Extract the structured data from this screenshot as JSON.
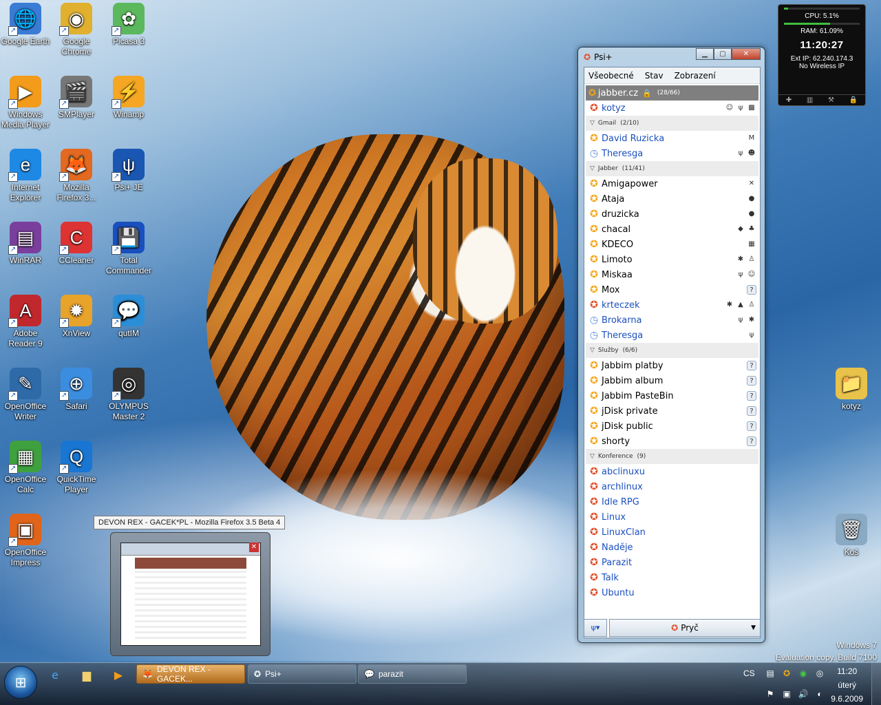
{
  "desktop": {
    "icons": [
      {
        "label": "Google Earth",
        "glyph": "🌐"
      },
      {
        "label": "Google Chrome",
        "glyph": "◉"
      },
      {
        "label": "Picasa 3",
        "glyph": "✿"
      },
      {
        "label": "Windows Media Player",
        "glyph": "▶"
      },
      {
        "label": "SMPlayer",
        "glyph": "🎬"
      },
      {
        "label": "Winamp",
        "glyph": "⚡"
      },
      {
        "label": "Internet Explorer",
        "glyph": "e"
      },
      {
        "label": "Mozilla Firefox 3...",
        "glyph": "🦊"
      },
      {
        "label": "Psi+ JE",
        "glyph": "ψ"
      },
      {
        "label": "WinRAR",
        "glyph": "▤"
      },
      {
        "label": "CCleaner",
        "glyph": "C"
      },
      {
        "label": "Total Commander",
        "glyph": "💾"
      },
      {
        "label": "Adobe Reader 9",
        "glyph": "A"
      },
      {
        "label": "XnView",
        "glyph": "✹"
      },
      {
        "label": "qutIM",
        "glyph": "💬"
      },
      {
        "label": "OpenOffice Writer",
        "glyph": "✎"
      },
      {
        "label": "Safari",
        "glyph": "⊕"
      },
      {
        "label": "OLYMPUS Master 2",
        "glyph": "◎"
      },
      {
        "label": "OpenOffice Calc",
        "glyph": "▦"
      },
      {
        "label": "QuickTime Player",
        "glyph": "Q"
      },
      {
        "label": "OpenOffice Impress",
        "glyph": "▣"
      },
      {
        "label": "kotyz",
        "glyph": "📁"
      },
      {
        "label": "Koš",
        "glyph": "🗑"
      }
    ]
  },
  "gadget": {
    "cpu": "CPU: 5.1%",
    "cpu_level": 0.05,
    "ram": "RAM: 61.09%",
    "ram_level": 0.61,
    "time": "11:20:27",
    "ext_ip": "Ext IP: 62.240.174.3",
    "wireless": "No Wireless IP"
  },
  "psi": {
    "title": "Psi+",
    "menu": [
      "Všeobecné",
      "Stav",
      "Zobrazení"
    ],
    "account": {
      "name": "jabber.cz",
      "count": "(28/66)"
    },
    "self": {
      "name": "kotyz",
      "icons": [
        "☺",
        "ψ",
        "▩"
      ]
    },
    "groups": [
      {
        "name": "Gmail",
        "count": "(2/10)",
        "contacts": [
          {
            "name": "David Ruzicka",
            "status": "online",
            "blue": true,
            "icons": [
              "M"
            ]
          },
          {
            "name": "Theresga",
            "status": "away",
            "blue": true,
            "icons": [
              "ψ",
              "☻"
            ]
          }
        ]
      },
      {
        "name": "Jabber",
        "count": "(11/41)",
        "contacts": [
          {
            "name": "Amigapower",
            "status": "online",
            "blue": false,
            "icons": [
              "✕"
            ]
          },
          {
            "name": "Ataja",
            "status": "online",
            "blue": false,
            "icons": [
              "●"
            ]
          },
          {
            "name": "druzicka",
            "status": "online",
            "blue": false,
            "icons": [
              "●"
            ]
          },
          {
            "name": "chacal",
            "status": "online",
            "blue": false,
            "icons": [
              "◆",
              "♣"
            ]
          },
          {
            "name": "KDECO",
            "status": "online",
            "blue": false,
            "icons": [
              "▦"
            ]
          },
          {
            "name": "Limoto",
            "status": "online",
            "blue": false,
            "icons": [
              "✱",
              "♙"
            ]
          },
          {
            "name": "Miskaa",
            "status": "online",
            "blue": false,
            "icons": [
              "ψ",
              "☺"
            ]
          },
          {
            "name": "Mox",
            "status": "online",
            "blue": false,
            "icons": [
              "?"
            ]
          },
          {
            "name": "krteczek",
            "status": "chat",
            "blue": true,
            "icons": [
              "✱",
              "▲",
              "♙"
            ]
          },
          {
            "name": "Brokarna",
            "status": "away",
            "blue": true,
            "icons": [
              "ψ",
              "✱"
            ]
          },
          {
            "name": "Theresga",
            "status": "away",
            "blue": true,
            "icons": [
              "ψ"
            ]
          }
        ]
      },
      {
        "name": "Služby",
        "count": "(6/6)",
        "contacts": [
          {
            "name": "Jabbim platby",
            "status": "online",
            "blue": false,
            "icons": [
              "?"
            ]
          },
          {
            "name": "Jabbim album",
            "status": "online",
            "blue": false,
            "icons": [
              "?"
            ]
          },
          {
            "name": "Jabbim PasteBin",
            "status": "online",
            "blue": false,
            "icons": [
              "?"
            ]
          },
          {
            "name": "jDisk private",
            "status": "online",
            "blue": false,
            "icons": [
              "?"
            ]
          },
          {
            "name": "jDisk public",
            "status": "online",
            "blue": false,
            "icons": [
              "?"
            ]
          },
          {
            "name": "shorty",
            "status": "online",
            "blue": false,
            "icons": [
              "?"
            ]
          }
        ]
      },
      {
        "name": "Konference",
        "count": "(9)",
        "contacts": [
          {
            "name": "abclinuxu",
            "status": "chat",
            "blue": true,
            "icons": []
          },
          {
            "name": "archlinux",
            "status": "chat",
            "blue": true,
            "icons": []
          },
          {
            "name": "Idle RPG",
            "status": "chat",
            "blue": true,
            "icons": []
          },
          {
            "name": "Linux",
            "status": "chat",
            "blue": true,
            "icons": []
          },
          {
            "name": "LinuxClan",
            "status": "chat",
            "blue": true,
            "icons": []
          },
          {
            "name": "Naděje",
            "status": "chat",
            "blue": true,
            "icons": []
          },
          {
            "name": "Parazit",
            "status": "chat",
            "blue": true,
            "icons": []
          },
          {
            "name": "Talk",
            "status": "chat",
            "blue": true,
            "icons": []
          },
          {
            "name": "Ubuntu",
            "status": "chat",
            "blue": true,
            "icons": []
          }
        ]
      }
    ],
    "status_button": "Pryč"
  },
  "thumbnail": {
    "tooltip": "DEVON REX - GACEK*PL - Mozilla Firefox 3.5 Beta 4"
  },
  "watermark": {
    "line1": "Windows 7",
    "line2": "Evaluation copy. Build 7100"
  },
  "taskbar": {
    "buttons": [
      {
        "label": "DEVON REX - GACEK...",
        "icon": "🦊",
        "active": true
      },
      {
        "label": "Psi+",
        "icon": "✪",
        "active": false
      },
      {
        "label": "parazit",
        "icon": "💬",
        "active": false
      }
    ],
    "lang": "CS",
    "time": "11:20",
    "day": "úterý",
    "date": "9.6.2009"
  },
  "colors": {
    "accent": "#1a4fbf",
    "status_online": "#f3a516",
    "status_away": "#5a8fd8",
    "status_chat": "#e24b26"
  }
}
